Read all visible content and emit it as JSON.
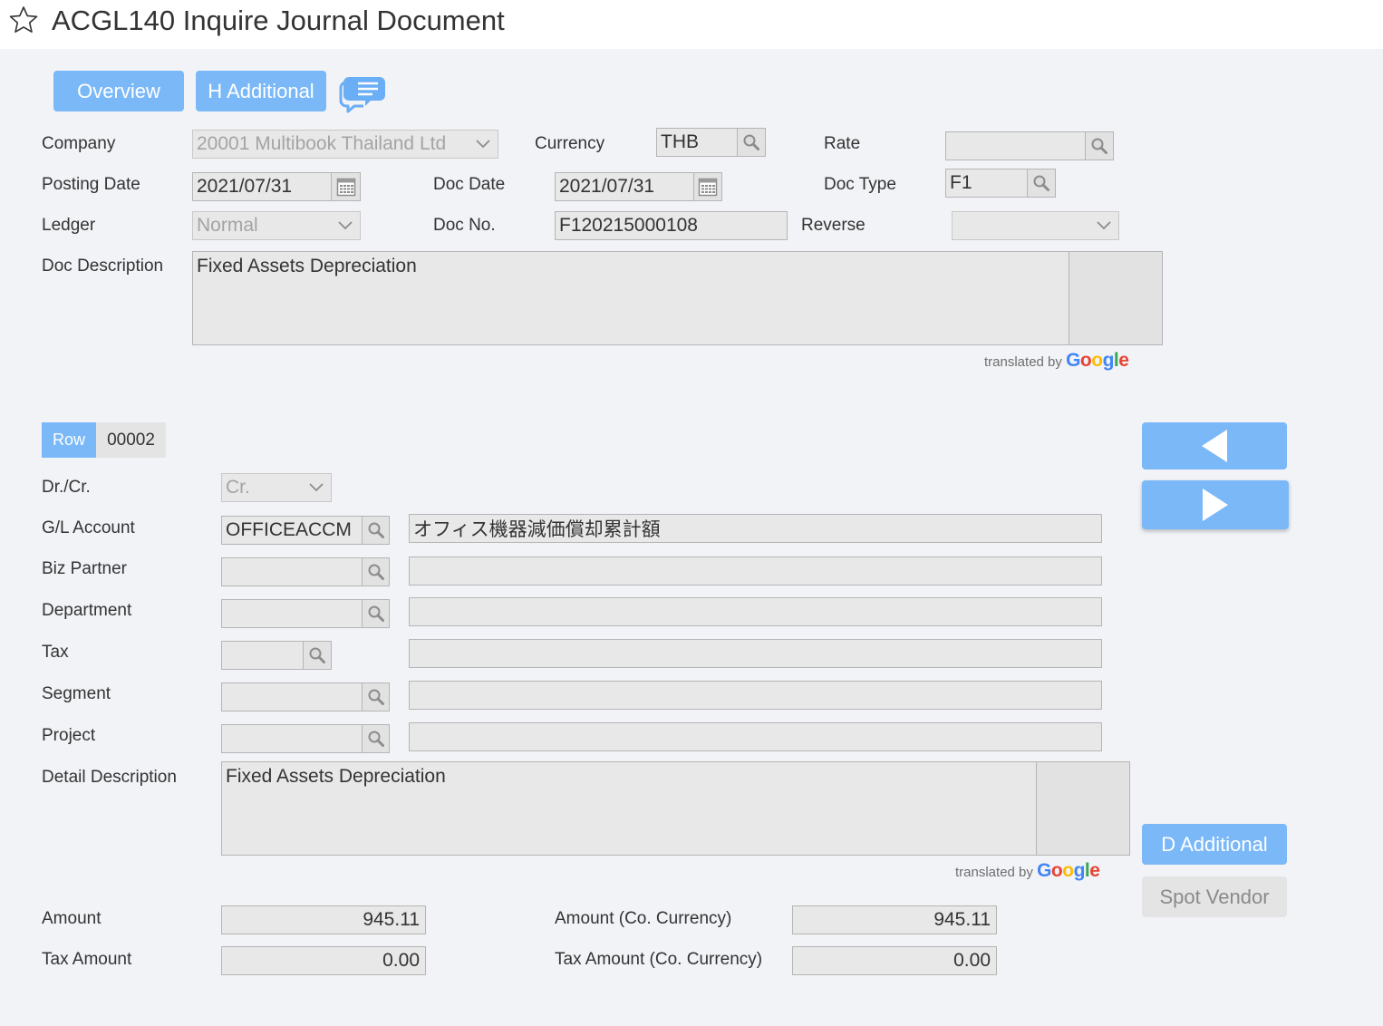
{
  "header": {
    "title": "ACGL140 Inquire Journal Document"
  },
  "toolbar": {
    "overview_label": "Overview",
    "h_additional_label": "H Additional"
  },
  "doc": {
    "company_label": "Company",
    "company_value": "20001 Multibook Thailand Ltd",
    "currency_label": "Currency",
    "currency_value": "THB",
    "rate_label": "Rate",
    "rate_value": "",
    "posting_date_label": "Posting Date",
    "posting_date_value": "2021/07/31",
    "doc_date_label": "Doc Date",
    "doc_date_value": "2021/07/31",
    "doc_type_label": "Doc Type",
    "doc_type_value": "F1",
    "ledger_label": "Ledger",
    "ledger_value": "Normal",
    "doc_no_label": "Doc No.",
    "doc_no_value": "F120215000108",
    "reverse_label": "Reverse",
    "reverse_value": "",
    "doc_desc_label": "Doc Description",
    "doc_desc_value": "Fixed Assets Depreciation"
  },
  "translated": {
    "prefix": "translated by",
    "brand": "Google"
  },
  "row": {
    "label": "Row",
    "value": "00002"
  },
  "detail": {
    "drcr_label": "Dr./Cr.",
    "drcr_value": "Cr.",
    "gl_label": "G/L Account",
    "gl_value": "OFFICEACCM",
    "gl_name": "オフィス機器減価償却累計額",
    "biz_label": "Biz Partner",
    "biz_value": "",
    "biz_name": "",
    "dept_label": "Department",
    "dept_value": "",
    "dept_name": "",
    "tax_label": "Tax",
    "tax_value": "",
    "tax_name": "",
    "segment_label": "Segment",
    "segment_value": "",
    "segment_name": "",
    "project_label": "Project",
    "project_value": "",
    "project_name": "",
    "desc_label": "Detail Description",
    "desc_value": "Fixed Assets Depreciation"
  },
  "side": {
    "d_additional_label": "D Additional",
    "spot_vendor_label": "Spot Vendor"
  },
  "amounts": {
    "amount_label": "Amount",
    "amount_value": "945.11",
    "amount_co_label": "Amount (Co. Currency)",
    "amount_co_value": "945.11",
    "tax_amount_label": "Tax Amount",
    "tax_amount_value": "0.00",
    "tax_amount_co_label": "Tax Amount (Co. Currency)",
    "tax_amount_co_value": "0.00"
  },
  "colors": {
    "accent": "#7bb8f7",
    "field_bg": "#e8e8e8",
    "page_bg": "#f2f3f7"
  }
}
